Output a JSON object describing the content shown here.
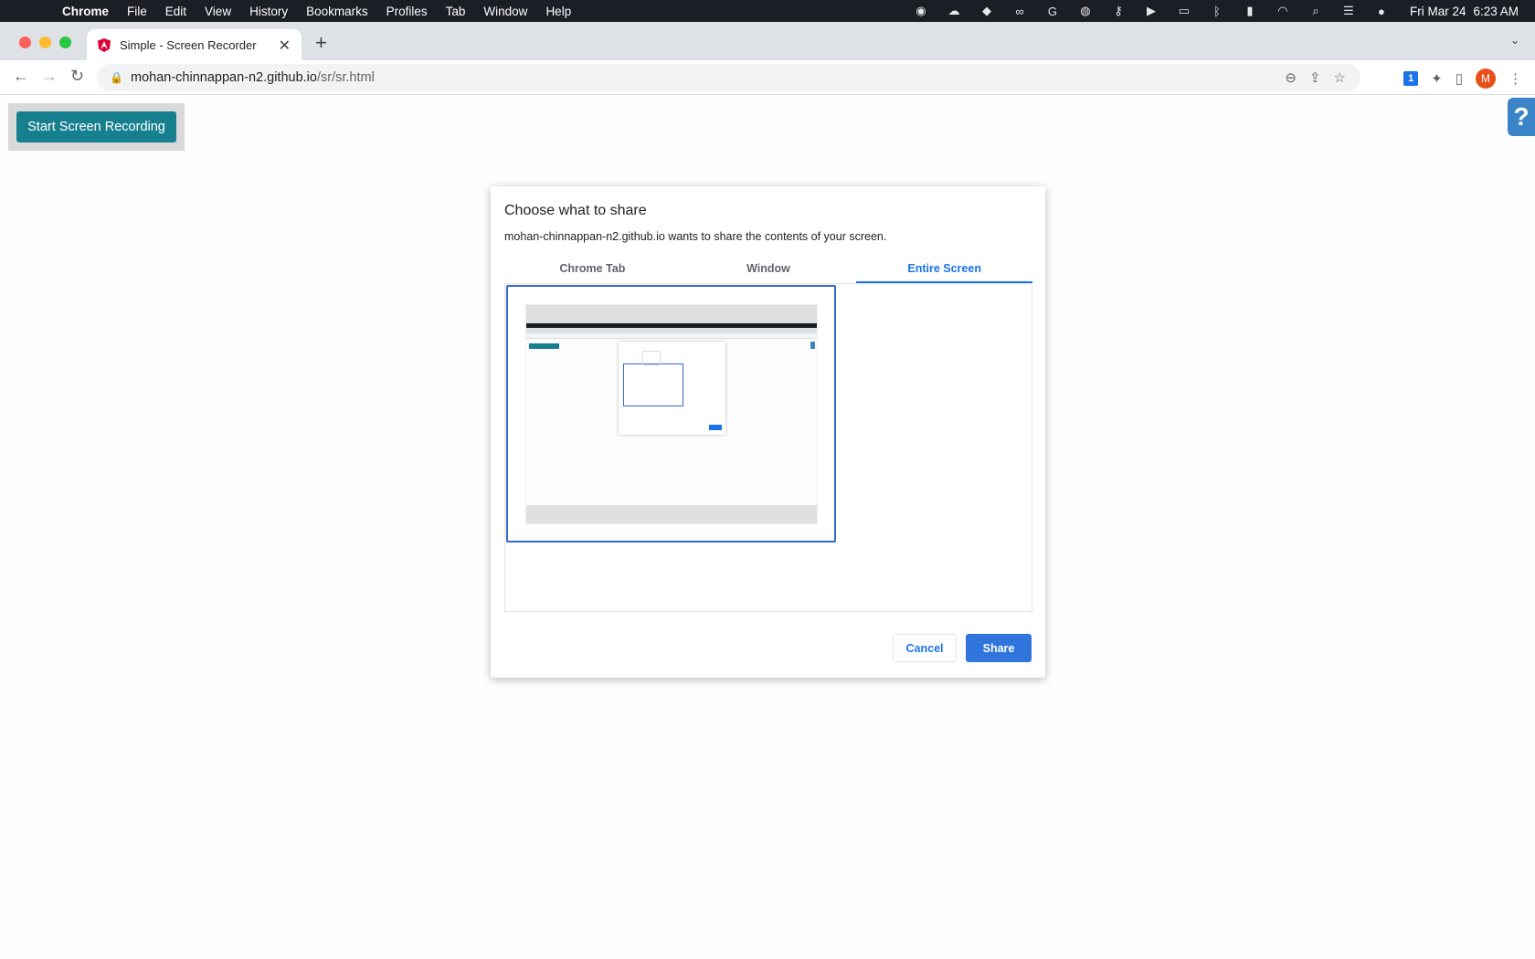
{
  "menubar": {
    "app": "Chrome",
    "items": [
      "File",
      "Edit",
      "View",
      "History",
      "Bookmarks",
      "Profiles",
      "Tab",
      "Window",
      "Help"
    ],
    "date": "Fri Mar 24",
    "time": "6:23 AM"
  },
  "browser": {
    "tab_title": "Simple - Screen Recorder",
    "url_host": "mohan-chinnappan-n2.github.io",
    "url_path": "/sr/sr.html",
    "profile_initial": "M"
  },
  "page": {
    "record_button": "Start Screen Recording",
    "help_button": "?"
  },
  "dialog": {
    "title": "Choose what to share",
    "subtitle": "mohan-chinnappan-n2.github.io wants to share the contents of your screen.",
    "tabs": [
      "Chrome Tab",
      "Window",
      "Entire Screen"
    ],
    "active_tab": "Entire Screen",
    "cancel": "Cancel",
    "share": "Share"
  },
  "colors": {
    "record_button": "#17808f",
    "accent": "#1a73e8",
    "share_button": "#2f75dc",
    "help_button": "#3a84c7"
  }
}
